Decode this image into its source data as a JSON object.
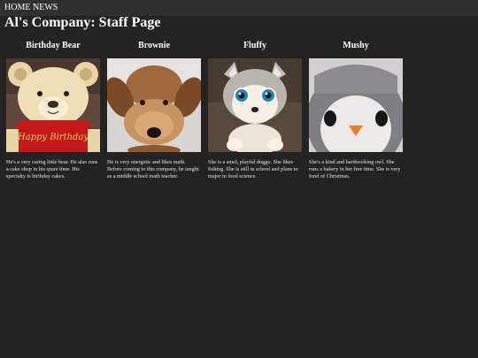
{
  "nav": {
    "items": [
      {
        "label": "HOME"
      },
      {
        "label": "NEWS"
      }
    ]
  },
  "page": {
    "title": "Al's Company: Staff Page"
  },
  "staff": [
    {
      "name": "Birthday Bear",
      "bio": "He's a very caring little bear. He also runs a cake shop in his spare time. His specialty is birthday cakes.",
      "photo_icon": "teddy-bear-plush",
      "shirt_text": "Happy Birthday"
    },
    {
      "name": "Brownie",
      "bio": "He is very energetic and likes math. Before coming to this company, he taught as a middle school math teacher.",
      "photo_icon": "brown-puppy-plush"
    },
    {
      "name": "Fluffy",
      "bio": "She is a smol, playful doggo. She likes fishing. She is still in school and plans to major in food science.",
      "photo_icon": "husky-puppy-plush"
    },
    {
      "name": "Mushy",
      "bio": "She's a kind and hardworking owl. She runs a bakery in her free time. She is very fond of Christmas.",
      "photo_icon": "penguin-owl-plush"
    }
  ],
  "colors": {
    "background": "#232323",
    "navbar": "#303030",
    "text": "#ffffff"
  }
}
